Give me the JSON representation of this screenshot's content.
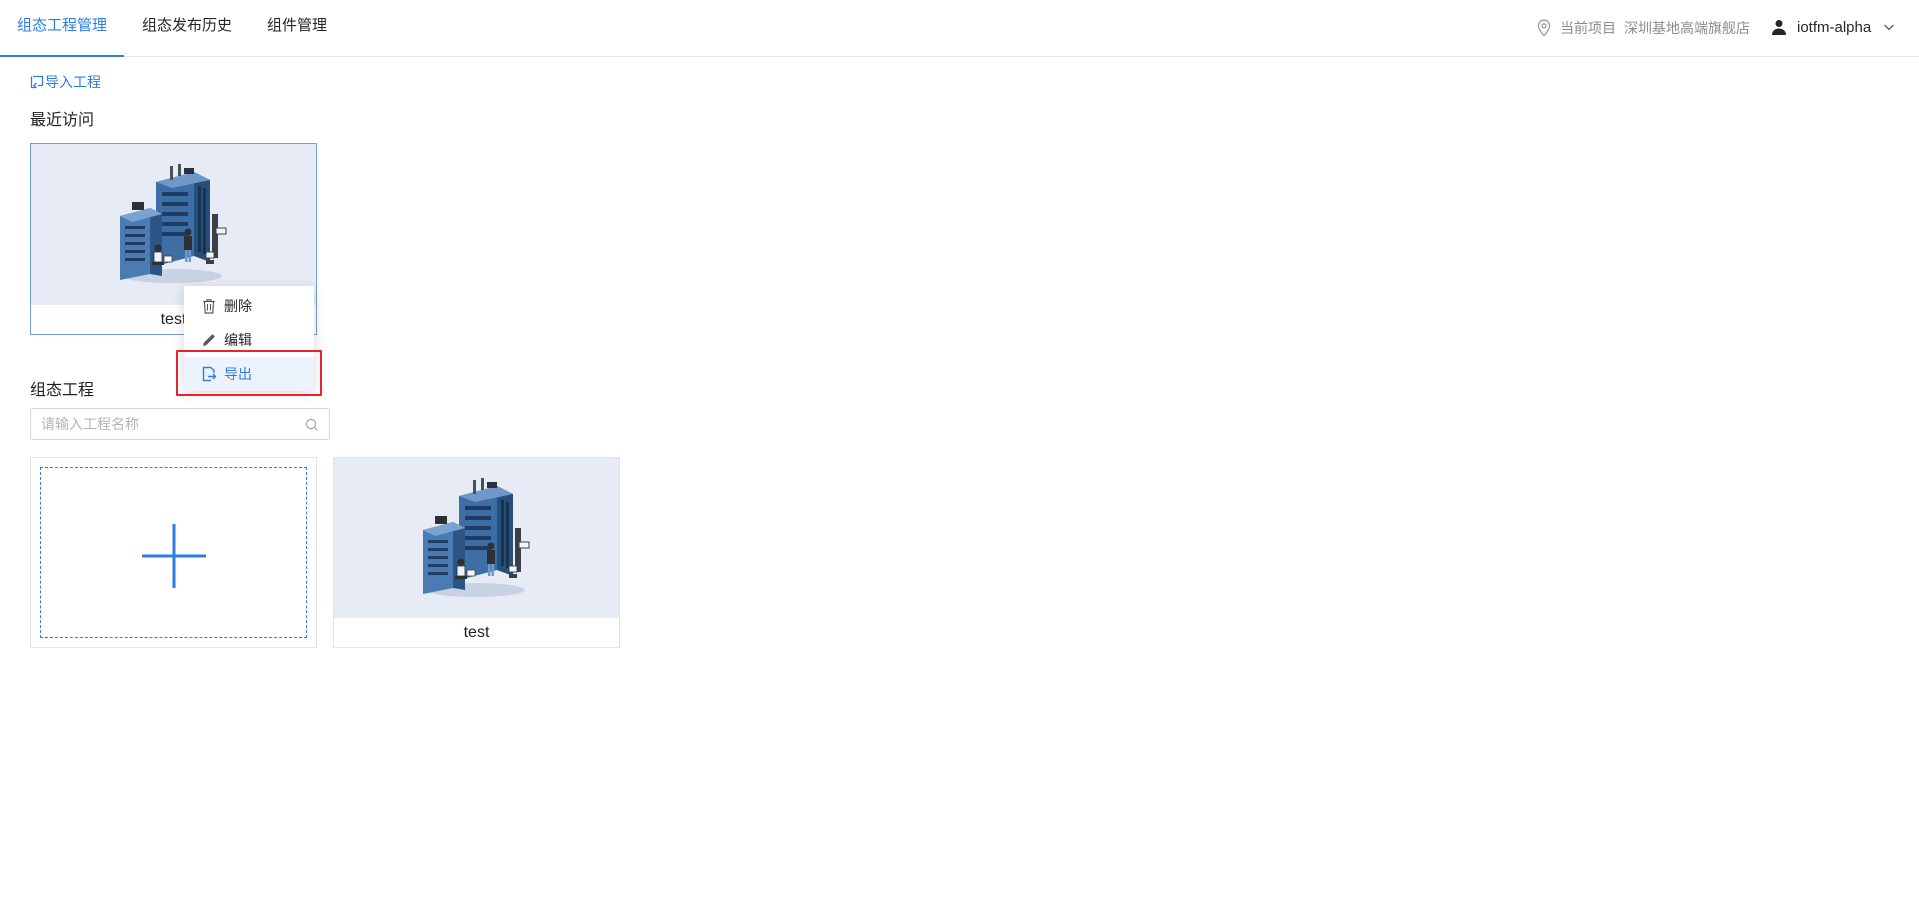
{
  "nav": {
    "tabs": [
      {
        "label": "组态工程管理",
        "active": true
      },
      {
        "label": "组态发布历史",
        "active": false
      },
      {
        "label": "组件管理",
        "active": false
      }
    ],
    "project_label": "当前项目",
    "project_name": "深圳基地高端旗舰店",
    "username": "iotfm-alpha",
    "icons": {
      "location": "location-pin-icon",
      "user": "user-icon",
      "dropdown": "chevron-down-icon"
    }
  },
  "main": {
    "import_label": "导入工程",
    "recent": {
      "title": "最近访问",
      "items": [
        {
          "name": "test"
        }
      ]
    },
    "projects": {
      "title": "组态工程",
      "search_placeholder": "请输入工程名称",
      "items": [
        {
          "name": "test"
        }
      ]
    }
  },
  "context_menu": {
    "items": [
      {
        "label": "删除",
        "icon": "trash-icon"
      },
      {
        "label": "编辑",
        "icon": "pencil-icon"
      },
      {
        "label": "导出",
        "icon": "export-icon",
        "highlighted": true
      }
    ]
  },
  "colors": {
    "accent": "#2f7de1",
    "highlight_box": "#e8252c",
    "thumbnail_bg": "#e6ebf5"
  }
}
